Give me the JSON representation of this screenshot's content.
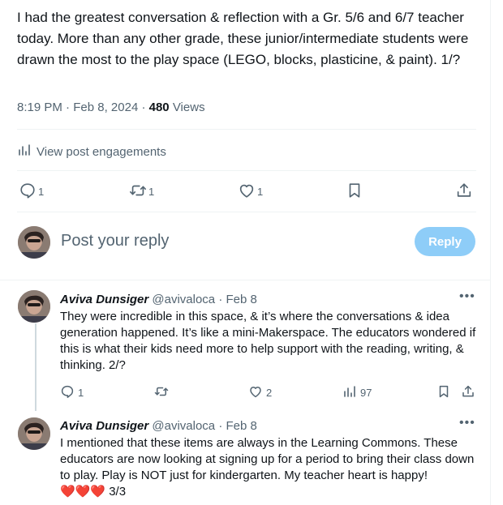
{
  "post": {
    "text": "I had the greatest conversation & reflection with a Gr. 5/6 and 6/7 teacher today. More than any other grade, these junior/intermediate students were drawn the most to the play space (LEGO, blocks, plasticine, & paint). 1/?",
    "time": "8:19 PM",
    "date": "Feb 8, 2024",
    "views_count": "480",
    "views_label": "Views",
    "engagements_label": "View post engagements",
    "replies": "1",
    "reposts": "1",
    "likes": "1"
  },
  "reply_box": {
    "placeholder": "Post your reply",
    "button_label": "Reply"
  },
  "replies": [
    {
      "name": "Aviva Dunsiger",
      "handle": "@avivaloca",
      "date": "Feb 8",
      "text": "They were incredible in this space, & it’s where the conversations & idea generation happened. It’s like a mini-Makerspace. The educators wondered if this is what their kids need more to help support with the reading, writing, & thinking. 2/?",
      "replies": "1",
      "reposts": "",
      "likes": "2",
      "views": "97"
    },
    {
      "name": "Aviva Dunsiger",
      "handle": "@avivaloca",
      "date": "Feb 8",
      "text": "I mentioned that these items are always in the Learning Commons. These educators are now looking at signing up for a period to bring their class down to play. Play is NOT just for kindergarten. My teacher heart is happy!",
      "emoji": "❤️❤️❤️",
      "suffix": "3/3"
    }
  ],
  "colors": {
    "accent": "#1d9bf0",
    "reply_button_disabled": "#8ecdf8",
    "heart": "#f91880"
  },
  "icons": [
    "analytics-icon",
    "reply-icon",
    "repost-icon",
    "like-icon",
    "bookmark-icon",
    "share-icon",
    "more-icon",
    "views-icon"
  ]
}
